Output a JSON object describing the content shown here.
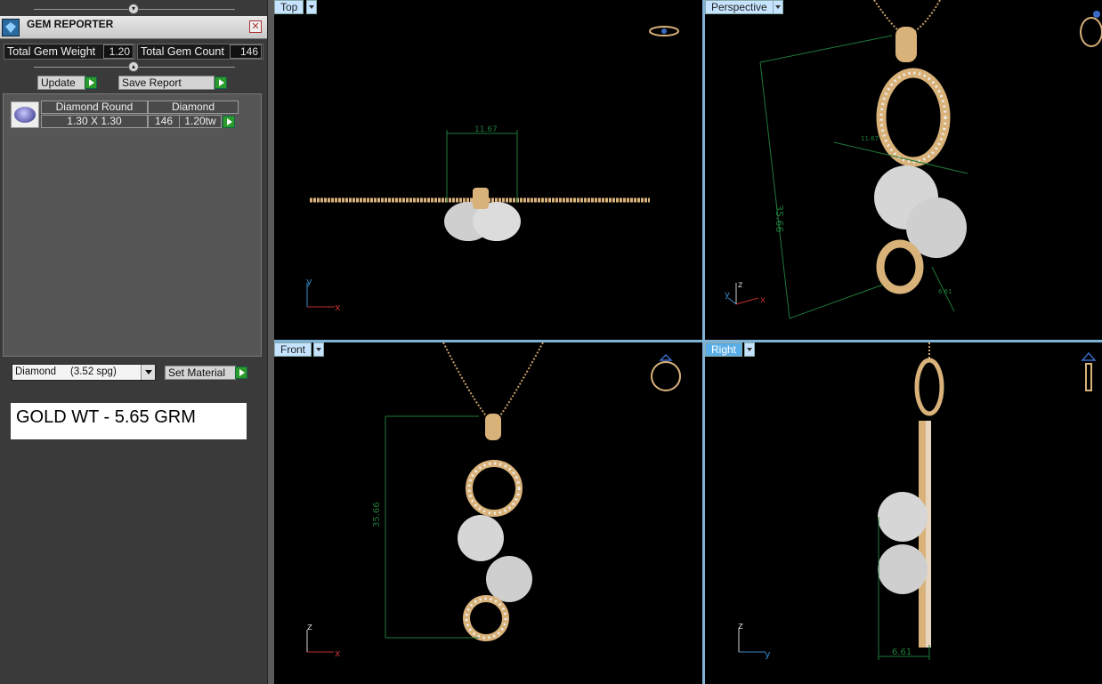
{
  "gem_reporter": {
    "title": "GEM REPORTER",
    "total_gem_weight_label": "Total Gem Weight",
    "total_gem_weight_value": "1.20",
    "total_gem_count_label": "Total Gem Count",
    "total_gem_count_value": "146",
    "update_label": "Update",
    "save_report_label": "Save Report",
    "gem_rows": [
      {
        "shape": "Diamond Round",
        "size": "1.30 X 1.30",
        "material": "Diamond",
        "count": "146",
        "weight": "1.20tw"
      }
    ],
    "material_select_value": "Diamond     (3.52 spg)",
    "set_material_label": "Set Material",
    "gold_weight_note": "GOLD WT - 5.65 GRM"
  },
  "viewports": {
    "top": {
      "label": "Top",
      "dimension": "11.67",
      "axis_1": "y",
      "axis_2": "x"
    },
    "perspective": {
      "label": "Perspective",
      "dimension_main": "35.66",
      "dimension_small_1": "11.67",
      "dimension_small_2": "6.61",
      "axis_1": "z",
      "axis_2": "y",
      "axis_3": "x"
    },
    "front": {
      "label": "Front",
      "dimension": "35.66",
      "axis_1": "z",
      "axis_2": "x"
    },
    "right": {
      "label": "Right",
      "dimension": "6.61",
      "axis_1": "z",
      "axis_2": "y"
    }
  },
  "colors": {
    "gold": "#d9b27a",
    "diamond": "#e8e8e8",
    "dimension_line": "#1f7a3a",
    "axis_x": "#c03030",
    "axis_y": "#3a8ac8",
    "axis_z": "#d0d0d0",
    "tab_active": "#5aaee8",
    "tab_inactive": "#c6e4ff"
  }
}
